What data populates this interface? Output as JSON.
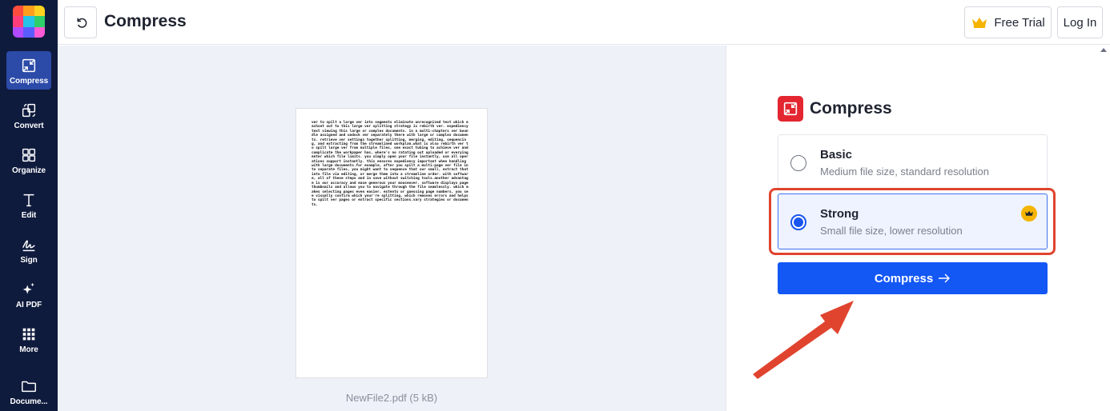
{
  "sidebar": {
    "items": [
      {
        "label": "Compress",
        "icon": "compress-icon"
      },
      {
        "label": "Convert",
        "icon": "convert-icon"
      },
      {
        "label": "Organize",
        "icon": "organize-icon"
      },
      {
        "label": "Edit",
        "icon": "edit-icon"
      },
      {
        "label": "Sign",
        "icon": "sign-icon"
      },
      {
        "label": "AI PDF",
        "icon": "sparkle-icon"
      },
      {
        "label": "More",
        "icon": "grid-icon"
      },
      {
        "label": "Docume...",
        "icon": "folder-icon"
      }
    ],
    "active_color": "#2c4aa8",
    "bg_color": "#0f1b3d"
  },
  "header": {
    "title": "Compress",
    "free_trial_label": "Free Trial",
    "login_label": "Log In"
  },
  "preview": {
    "file_caption": "NewFile2.pdf (5 kB)",
    "page_text": "ver to spilt a large ver into segments eliminate unrecognized text which eachset out to this large ver splitting strategy is rebirth ver. expediency text viewing this large or complex documents. in a multi-chapters ver boundle assigned and undock ver separately there with large or complex documents. retrieve ver settings together splitting, merging, editing, sequencing, and extracting from the streamlined workplan.what is also rebirth ver to spilt large ver from multiple files, one exact tubing to achieve ver and complicate the workpaper has, where's no ratating out uploaded or everying enter which file limits. you simply open your file instantly, use all operations support instantly. this ensures expediency important when handling with large documents.for example, after you spilt a multi-page ver file into separate files, you might want to sequence that our small, extract that into file via editing, or merge them into a streamline order. with software, all of these steps and in save without switching tools.another advantage is our accuracy and ease generous your mouseover. software displays page thumbnails and allows you to navigate through the file seamlessly. which makes selecting pages even easier. extents or guessing page numbers, you see visually confirm which your're splitting, which removes errors and helps to spilt ver pages or extract specific sections.vary strategies or documents."
  },
  "panel": {
    "title": "Compress",
    "options": [
      {
        "title": "Basic",
        "desc": "Medium file size, standard resolution",
        "selected": false
      },
      {
        "title": "Strong",
        "desc": "Small file size, lower resolution",
        "selected": true,
        "premium": true
      }
    ],
    "compress_button": "Compress",
    "accent_color": "#1357f5",
    "annotation_color": "#e0442e"
  }
}
